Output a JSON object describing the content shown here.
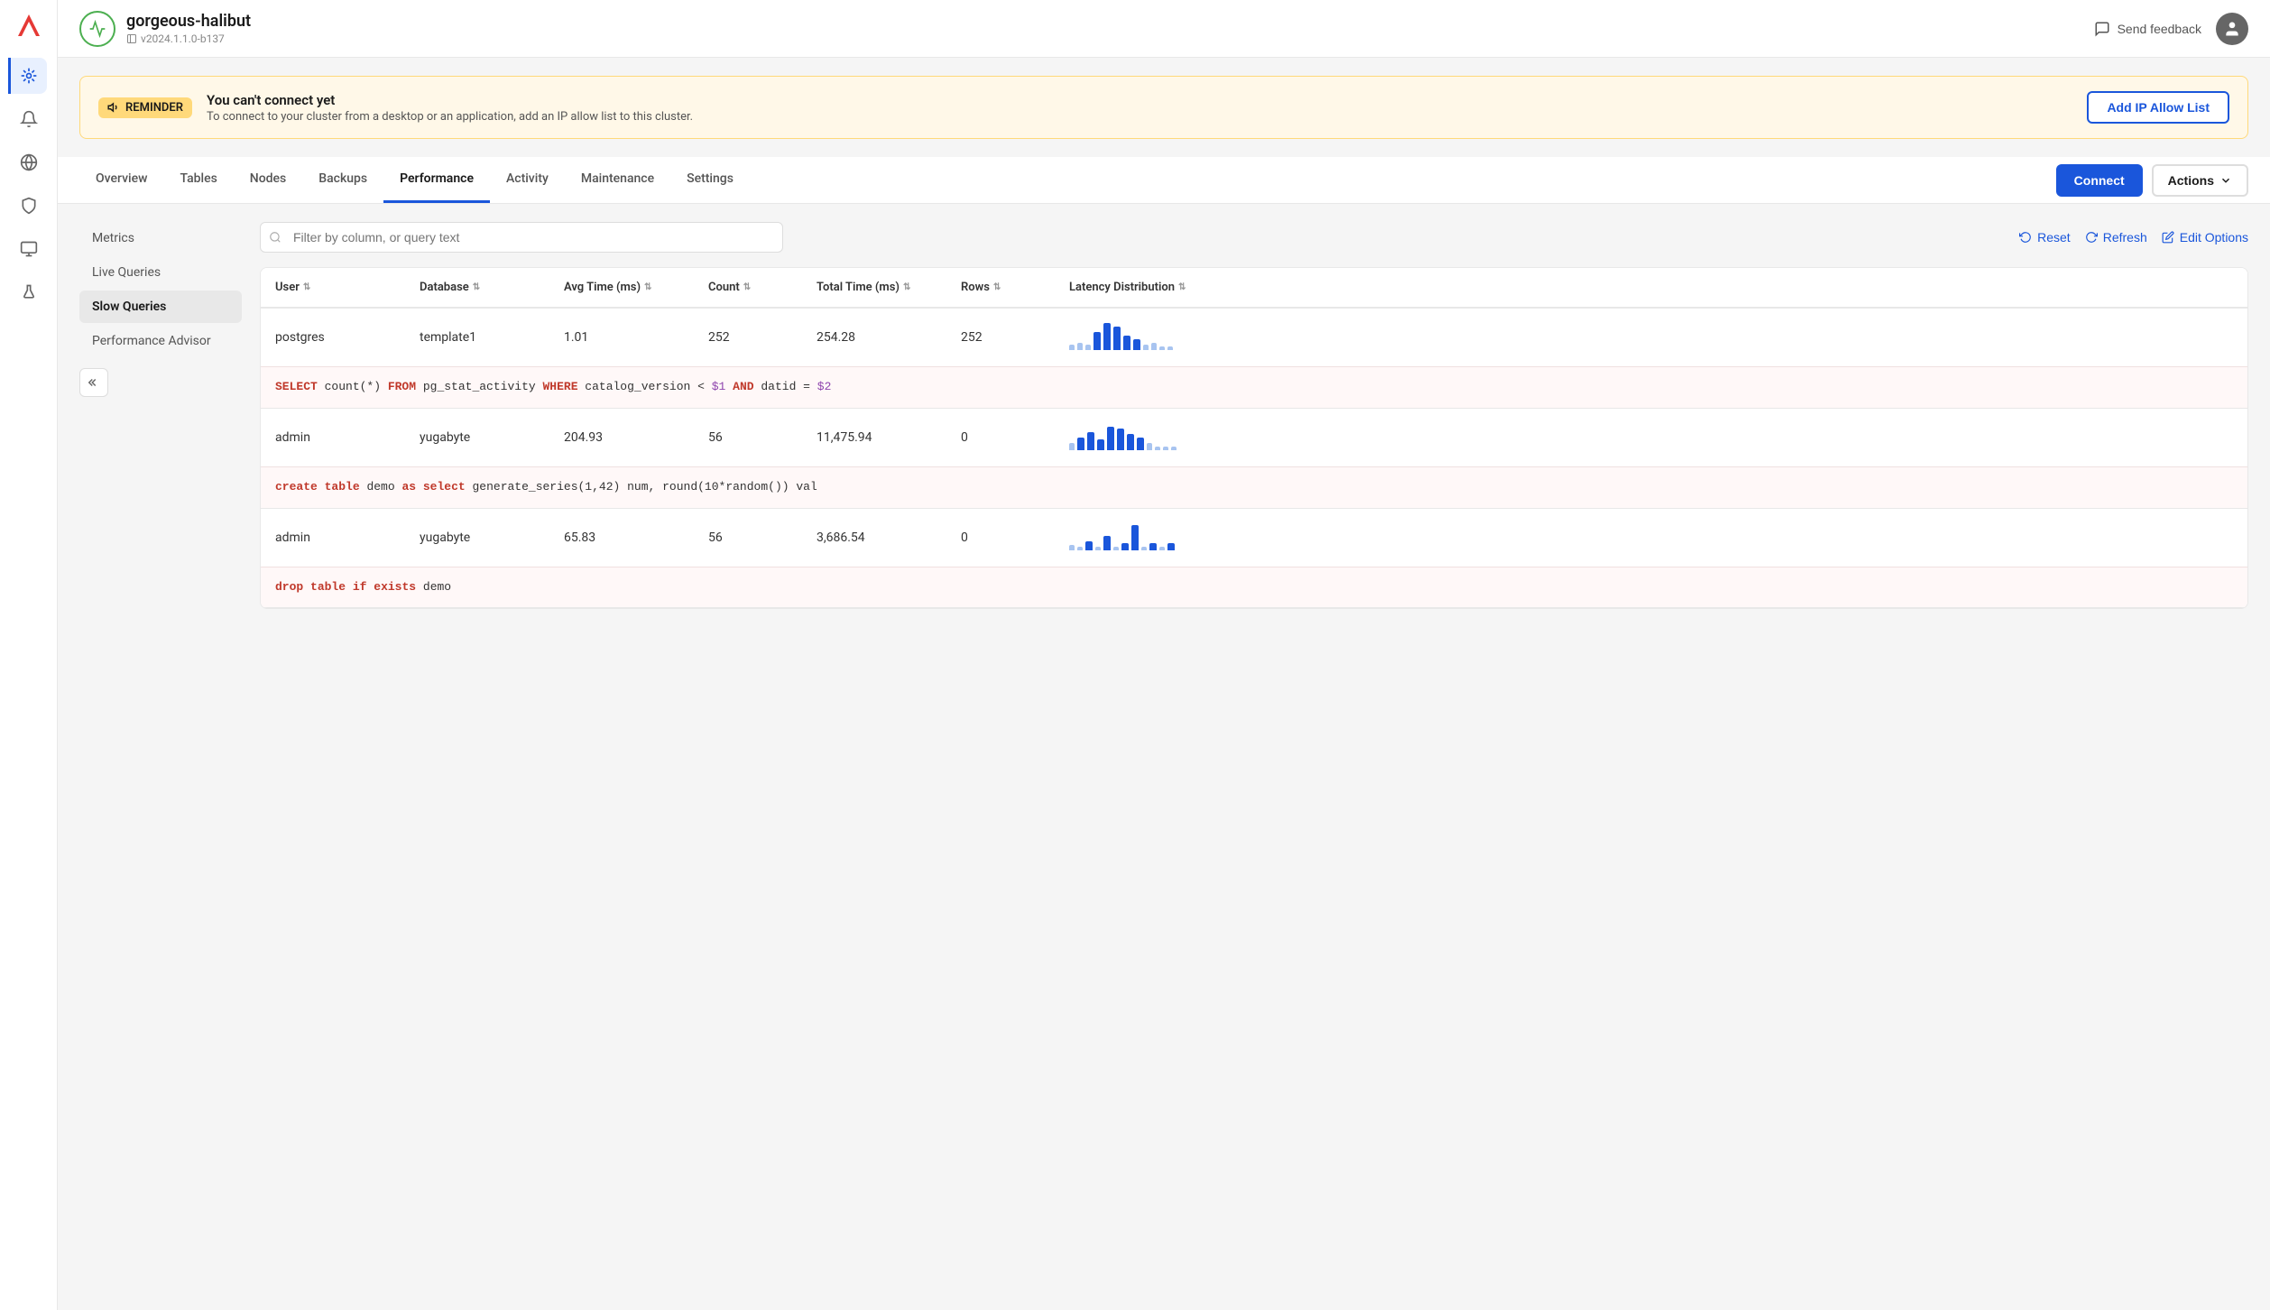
{
  "app": {
    "logo_text": "Y"
  },
  "cluster": {
    "name": "gorgeous-halibut",
    "version": "v2024.1.1.0-b137",
    "icon_color": "#4CAF50"
  },
  "header": {
    "send_feedback": "Send feedback",
    "avatar_initial": ""
  },
  "banner": {
    "badge_label": "REMINDER",
    "title": "You can't connect yet",
    "description": "To connect to your cluster from a desktop or an application, add an IP allow list to this cluster.",
    "button_label": "Add IP Allow List"
  },
  "tabs": [
    {
      "id": "overview",
      "label": "Overview"
    },
    {
      "id": "tables",
      "label": "Tables"
    },
    {
      "id": "nodes",
      "label": "Nodes"
    },
    {
      "id": "backups",
      "label": "Backups"
    },
    {
      "id": "performance",
      "label": "Performance"
    },
    {
      "id": "activity",
      "label": "Activity"
    },
    {
      "id": "maintenance",
      "label": "Maintenance"
    },
    {
      "id": "settings",
      "label": "Settings"
    }
  ],
  "active_tab": "performance",
  "connect_btn": "Connect",
  "actions_btn": "Actions",
  "sidebar_items": [
    {
      "id": "metrics",
      "label": "Metrics"
    },
    {
      "id": "live-queries",
      "label": "Live Queries"
    },
    {
      "id": "slow-queries",
      "label": "Slow Queries"
    },
    {
      "id": "performance-advisor",
      "label": "Performance Advisor"
    }
  ],
  "active_sidebar": "slow-queries",
  "filter_placeholder": "Filter by column, or query text",
  "toolbar": {
    "reset_label": "Reset",
    "refresh_label": "Refresh",
    "edit_options_label": "Edit Options"
  },
  "table_columns": [
    {
      "id": "user",
      "label": "User"
    },
    {
      "id": "database",
      "label": "Database"
    },
    {
      "id": "avg_time",
      "label": "Avg Time (ms)"
    },
    {
      "id": "count",
      "label": "Count"
    },
    {
      "id": "total_time",
      "label": "Total Time (ms)"
    },
    {
      "id": "rows",
      "label": "Rows"
    },
    {
      "id": "latency",
      "label": "Latency Distribution"
    }
  ],
  "rows": [
    {
      "user": "postgres",
      "database": "template1",
      "avg_time": "1.01",
      "count": "252",
      "total_time": "254.28",
      "rows": "252",
      "query": "SELECT count(*) FROM pg_stat_activity WHERE catalog_version < $1 AND datid = $2",
      "bars": [
        2,
        3,
        2,
        8,
        12,
        10,
        6,
        4,
        2,
        3,
        2,
        1
      ]
    },
    {
      "user": "admin",
      "database": "yugabyte",
      "avg_time": "204.93",
      "count": "56",
      "total_time": "11,475.94",
      "rows": "0",
      "query": "create table demo as select generate_series(1,42) num, round(10*random()) val",
      "bars": [
        4,
        6,
        8,
        5,
        10,
        9,
        7,
        5,
        3,
        2,
        1,
        1
      ]
    },
    {
      "user": "admin",
      "database": "yugabyte",
      "avg_time": "65.83",
      "count": "56",
      "total_time": "3,686.54",
      "rows": "0",
      "query": "drop table if exists demo",
      "bars": [
        2,
        1,
        3,
        1,
        5,
        1,
        2,
        8,
        1,
        2,
        1,
        2
      ]
    }
  ]
}
